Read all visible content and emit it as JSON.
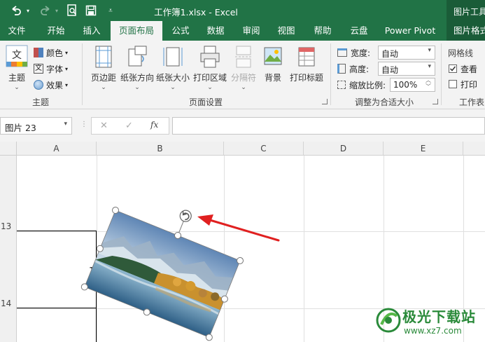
{
  "window": {
    "title": "工作簿1.xlsx  -  Excel",
    "context_tab_group": "图片工具"
  },
  "quick_access": {
    "undo": "undo-icon",
    "redo": "redo-icon",
    "print_preview": "print-preview-icon",
    "save": "save-icon",
    "customize": "customize-icon"
  },
  "tabs": [
    "文件",
    "开始",
    "插入",
    "页面布局",
    "公式",
    "数据",
    "审阅",
    "视图",
    "帮助",
    "云盘",
    "Power Pivot",
    "图片格式"
  ],
  "active_tab": "页面布局",
  "ribbon": {
    "themes": {
      "theme_label": "主题",
      "colors_label": "颜色",
      "fonts_label": "字体",
      "effects_label": "效果",
      "group_label": "主题",
      "theme_glyph": "文"
    },
    "page_setup": {
      "margins": "页边距",
      "orientation": "纸张方向",
      "size": "纸张大小",
      "print_area": "打印区域",
      "breaks": "分隔符",
      "background": "背景",
      "print_titles": "打印标题",
      "group_label": "页面设置"
    },
    "scale_to_fit": {
      "width_label": "宽度:",
      "width_value": "自动",
      "height_label": "高度:",
      "height_value": "自动",
      "scale_label": "缩放比例:",
      "scale_value": "100%",
      "group_label": "调整为合适大小"
    },
    "sheet_options": {
      "gridlines_label": "网格线",
      "view_label": "查看",
      "view_checked": true,
      "print_label": "打印",
      "print_checked": false,
      "group_label": "工作表"
    }
  },
  "formula_bar": {
    "name_box": "图片 23",
    "cancel_icon": "✕",
    "enter_icon": "✓",
    "fx_label": "fx",
    "formula": ""
  },
  "grid": {
    "columns": [
      "A",
      "B",
      "C",
      "D",
      "E"
    ],
    "rows": [
      "13",
      "14"
    ],
    "partial_cell_text": "1"
  },
  "picture": {
    "name": "图片 23",
    "content": "mountain lake landscape photo, rotated, with rotate handle"
  },
  "annotation": {
    "arrow_color": "#e02020",
    "points_to": "rotate-handle"
  },
  "watermark": {
    "name": "极光下载站",
    "url": "www.xz7.com"
  },
  "colors": {
    "excel_green": "#217346",
    "ribbon_bg": "#f3f3f3"
  }
}
